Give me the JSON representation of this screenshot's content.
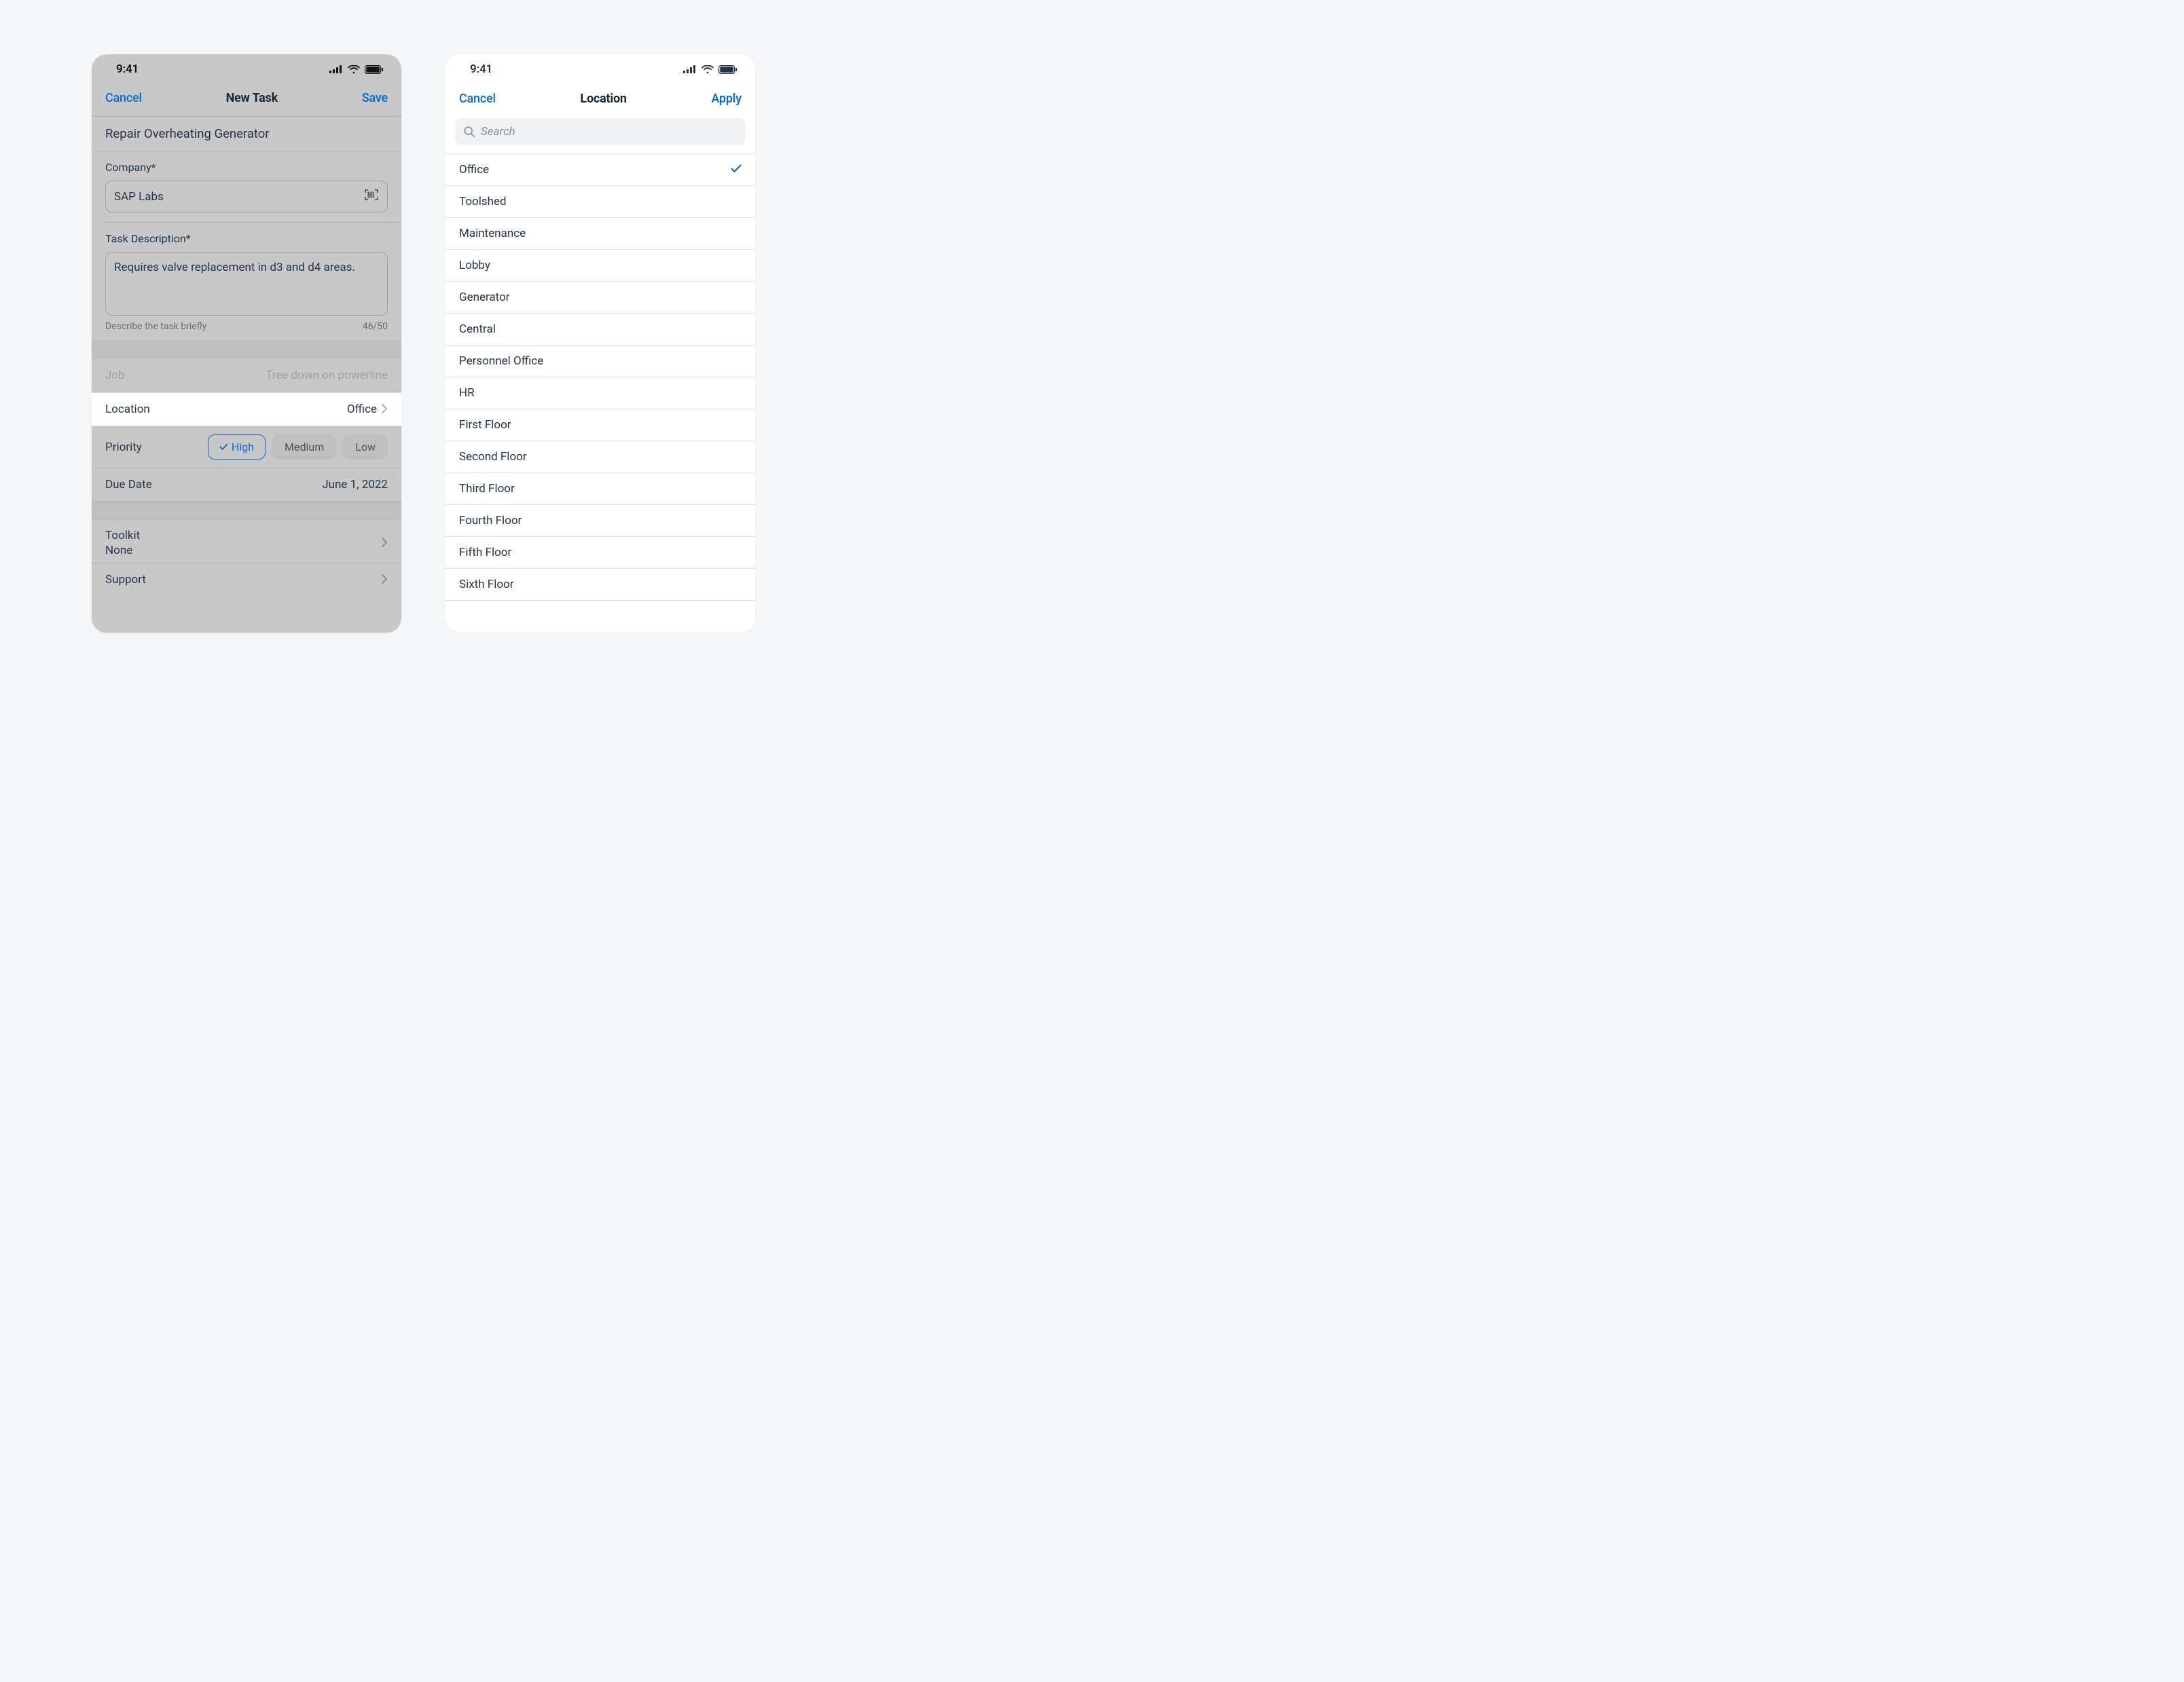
{
  "status_time": "9:41",
  "left": {
    "nav": {
      "cancel": "Cancel",
      "title": "New Task",
      "save": "Save"
    },
    "title_value": "Repair Overheating Generator",
    "company": {
      "label": "Company*",
      "value": "SAP Labs"
    },
    "description": {
      "label": "Task Description*",
      "value": "Requires valve replacement in d3 and d4 areas.",
      "hint": "Describe the task briefly",
      "counter": "46/50"
    },
    "job": {
      "label": "Job",
      "value": "Tree down on powerline"
    },
    "location": {
      "label": "Location",
      "value": "Office"
    },
    "priority": {
      "label": "Priority",
      "options": {
        "high": "High",
        "medium": "Medium",
        "low": "Low"
      },
      "selected": "high"
    },
    "duedate": {
      "label": "Due Date",
      "value": "June 1, 2022"
    },
    "toolkit": {
      "label": "Toolkit",
      "value": "None"
    },
    "support": {
      "label": "Support"
    }
  },
  "right": {
    "nav": {
      "cancel": "Cancel",
      "title": "Location",
      "apply": "Apply"
    },
    "search_placeholder": "Search",
    "selected_index": 0,
    "items": [
      "Office",
      "Toolshed",
      "Maintenance",
      "Lobby",
      "Generator",
      "Central",
      "Personnel Office",
      "HR",
      "First Floor",
      "Second Floor",
      "Third Floor",
      "Fourth Floor",
      "Fifth Floor",
      "Sixth Floor"
    ]
  }
}
